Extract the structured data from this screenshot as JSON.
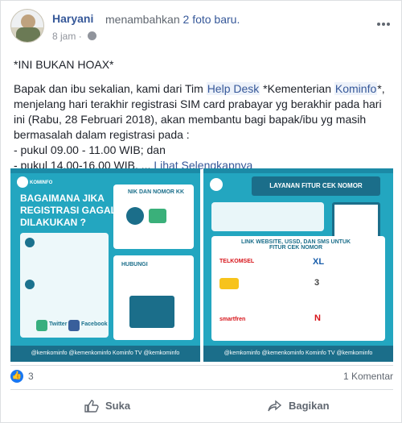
{
  "post": {
    "author": "Haryani",
    "action_text": "menambahkan",
    "action_link": "2 foto baru.",
    "time": "8 jam",
    "separator": "·"
  },
  "body": {
    "headline": "*INI BUKAN HOAX*",
    "p1_a": "Bapak dan ibu sekalian, kami dari Tim ",
    "link_helpdesk": "Help Desk",
    "p1_b": " *Kementerian ",
    "link_kominfo": "Kominfo",
    "p1_c": "*, menjelang hari terakhir registrasi SIM card prabayar yg berakhir pada hari ini (Rabu, 28 Februari 2018), akan membantu bagi bapak/ibu yg masih bermasalah dalam registrasi pada :",
    "line1": "- pukul 09.00 - 11.00 WIB; dan",
    "line2": "- pukul 14.00-16.00 WIB, ... ",
    "see_more": "Lihat Selengkapnya"
  },
  "photos": {
    "left": {
      "logo": "KOMINFO",
      "title": "Bagaimana jika Registrasi Gagal Dilakukan ?",
      "box_title": "NIK DAN NOMOR KK",
      "hubungi": "HUBUNGI",
      "twitter": "Twitter",
      "facebook": "Facebook",
      "footer": "@kemkominfo   @kemenkominfo   Kominfo TV   @kemkominfo"
    },
    "right": {
      "banner": "LAYANAN FITUR CEK NOMOR",
      "box_title": "LINK WEBSITE, USSD, DAN SMS UNTUK FITUR CEK NOMOR",
      "op1": "TELKOMSEL",
      "op2": "XL",
      "op3": "3",
      "op4": "smartfren",
      "op5": "N",
      "footer": "@kemkominfo   @kemenkominfo   Kominfo TV   @kemkominfo"
    }
  },
  "stats": {
    "likes": "3",
    "comments": "1 Komentar"
  },
  "actions": {
    "like": "Suka",
    "share": "Bagikan"
  },
  "colors": {
    "link": "#365899",
    "infographic": "#23a6c0",
    "like_blue": "#1877f2"
  }
}
